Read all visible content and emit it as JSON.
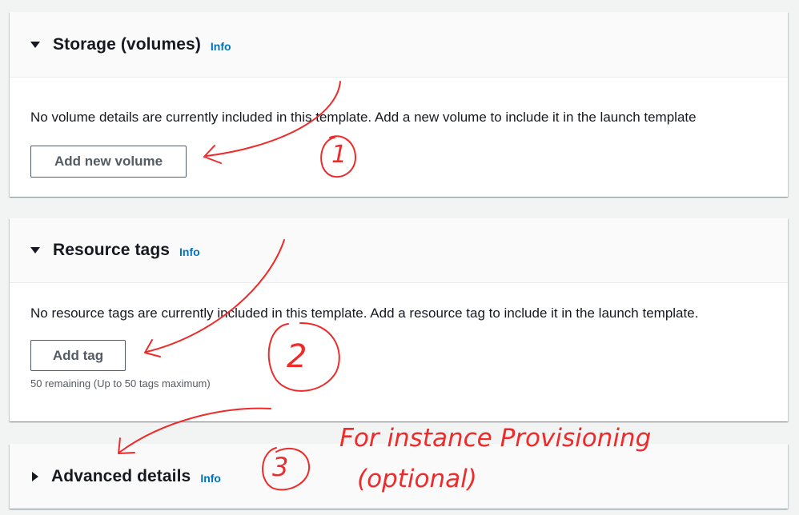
{
  "storage": {
    "title": "Storage (volumes)",
    "info": "Info",
    "description": "No volume details are currently included in this template. Add a new volume to include it in the launch template",
    "button": "Add new volume"
  },
  "tags": {
    "title": "Resource tags",
    "info": "Info",
    "description": "No resource tags are currently included in this template. Add a resource tag to include it in the launch template.",
    "button": "Add tag",
    "remaining": "50 remaining (Up to 50 tags maximum)"
  },
  "advanced": {
    "title": "Advanced details",
    "info": "Info"
  },
  "annotations": {
    "step1": "1",
    "step2": "2",
    "step3": "3",
    "note_line1": "For instance Provisioning",
    "note_line2": "(optional)",
    "color": "#ee2b2b"
  }
}
